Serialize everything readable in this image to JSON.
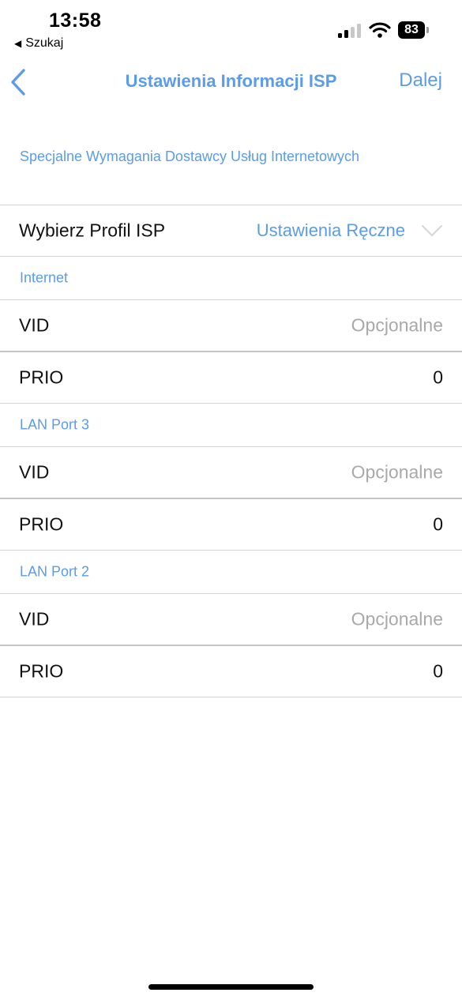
{
  "status_bar": {
    "time": "13:58",
    "back_app": "Szukaj",
    "battery": "83"
  },
  "nav": {
    "title": "Ustawienia Informacji ISP",
    "next_label": "Dalej"
  },
  "intro": "Specjalne Wymagania Dostawcy Usług Internetowych",
  "profile": {
    "label": "Wybierz Profil ISP",
    "value": "Ustawienia Ręczne"
  },
  "sections": [
    {
      "title": "Internet",
      "vid_label": "VID",
      "vid_placeholder": "Opcjonalne",
      "prio_label": "PRIO",
      "prio_value": "0"
    },
    {
      "title": "LAN Port 3",
      "vid_label": "VID",
      "vid_placeholder": "Opcjonalne",
      "prio_label": "PRIO",
      "prio_value": "0"
    },
    {
      "title": "LAN Port 2",
      "vid_label": "VID",
      "vid_placeholder": "Opcjonalne",
      "prio_label": "PRIO",
      "prio_value": "0"
    }
  ],
  "colors": {
    "accent": "#5b9cea",
    "placeholder": "#a9a9a9",
    "divider": "#d4d4d4"
  }
}
